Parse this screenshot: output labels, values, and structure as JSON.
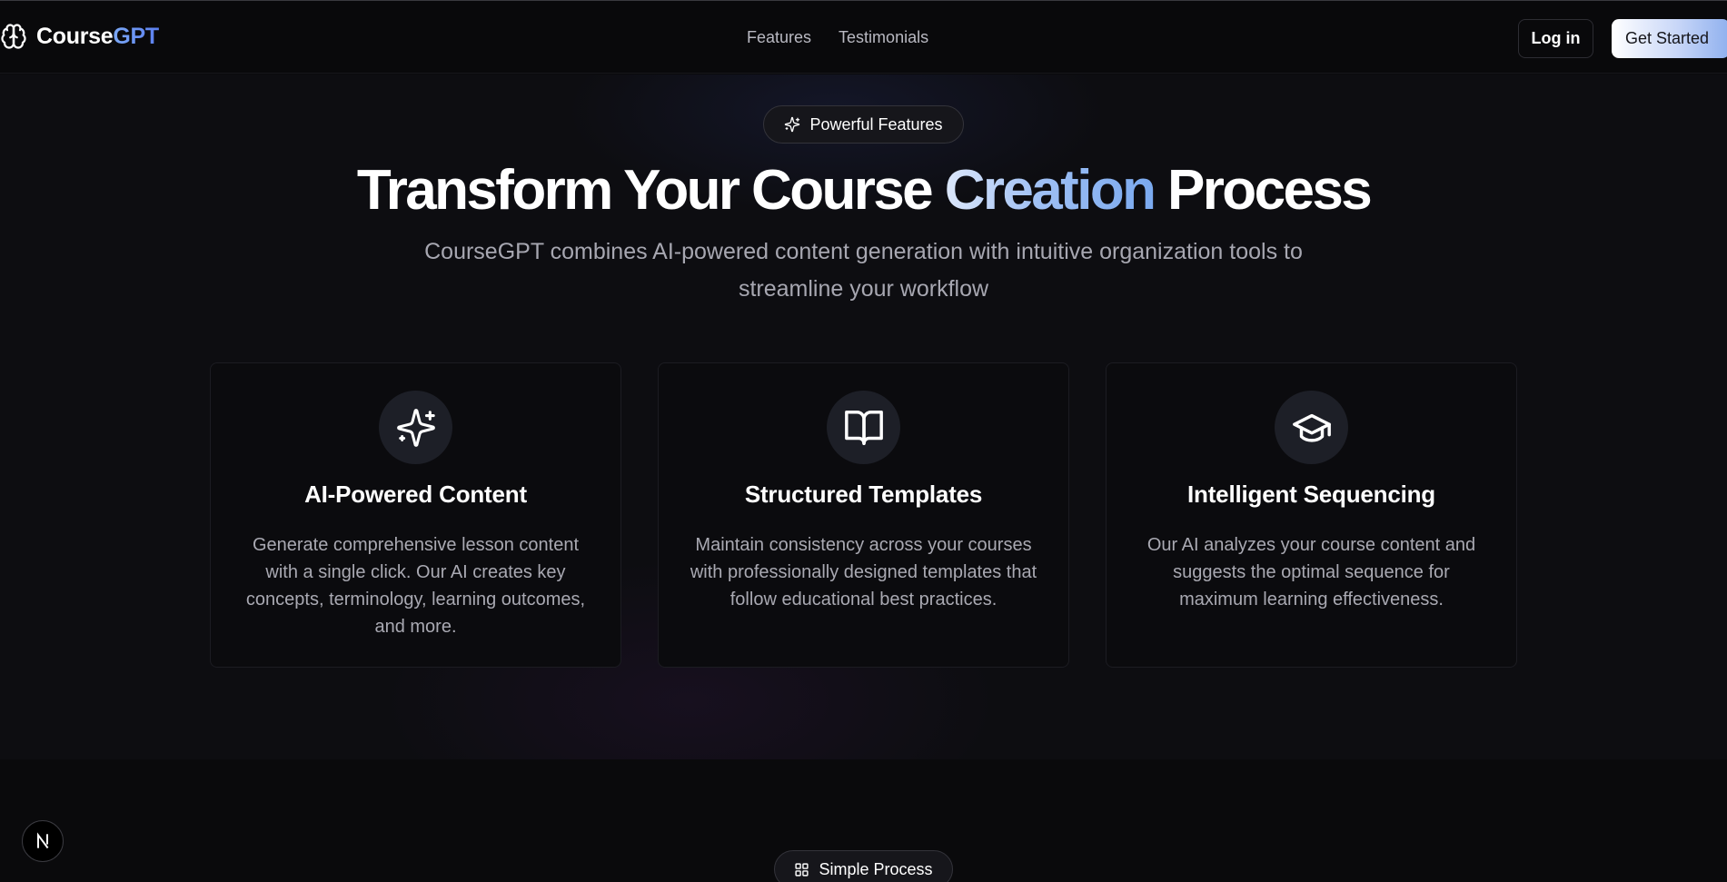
{
  "header": {
    "brand_part1": "Course",
    "brand_part2": "GPT",
    "brand_icon": "brain-icon",
    "nav": [
      {
        "label": "Features"
      },
      {
        "label": "Testimonials"
      }
    ],
    "login_label": "Log in",
    "get_started_label": "Get Started"
  },
  "features": {
    "badge_label": "Powerful Features",
    "badge_icon": "sparkles-icon",
    "headline_part1": "Transform Your Course",
    "headline_highlight": "Creation",
    "headline_part2": "Process",
    "subtitle": "CourseGPT combines AI-powered content generation with intuitive organization tools to streamline your workflow",
    "cards": [
      {
        "icon": "sparkles-icon",
        "title": "AI-Powered Content",
        "description": "Generate comprehensive lesson content with a single click. Our AI creates key concepts, terminology, learning outcomes, and more."
      },
      {
        "icon": "book-open-icon",
        "title": "Structured Templates",
        "description": "Maintain consistency across your courses with professionally designed templates that follow educational best practices."
      },
      {
        "icon": "graduation-cap-icon",
        "title": "Intelligent Sequencing",
        "description": "Our AI analyzes your course content and suggests the optimal sequence for maximum learning effectiveness."
      }
    ]
  },
  "process": {
    "badge_label": "Simple Process",
    "badge_icon": "grid-icon"
  },
  "colors": {
    "background": "#0a0a0c",
    "accent_blue": "#7aa9ef",
    "text_muted": "#a9a9b2"
  }
}
